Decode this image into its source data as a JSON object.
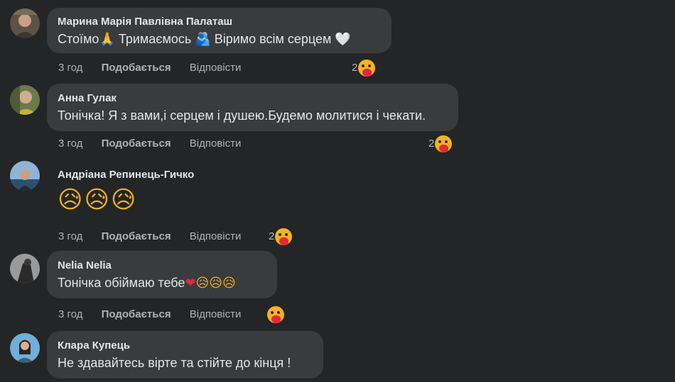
{
  "comments": [
    {
      "author": "Марина Марія Павлівна Палаташ",
      "text_parts": [
        "Стоїмо",
        "🙏",
        " Тримаємось ",
        "🫂",
        " Віримо всім серцем ",
        "🤍"
      ],
      "time": "3 год",
      "like": "Подобається",
      "reply": "Відповісти",
      "reaction_count": "2"
    },
    {
      "author": "Анна Гулак",
      "text": "Тонічка! Я з вами,і серцем і душею.Будемо молитися і чекати.",
      "time": "3 год",
      "like": "Подобається",
      "reply": "Відповісти",
      "reaction_count": "2"
    },
    {
      "author": "Андріана Репинець-Гичко",
      "emoji_text": "😥😥😥",
      "time": "3 год",
      "like": "Подобається",
      "reply": "Відповісти",
      "reaction_count": "2"
    },
    {
      "author": "Nelia Nelia",
      "text": "Тонічка обіймаю тебе",
      "text_emoji_heart": "❤",
      "text_emoji_tail": "😥😥😥",
      "time": "3 год",
      "like": "Подобається",
      "reply": "Відповісти",
      "reaction_count": ""
    },
    {
      "author": "Клара Купець",
      "text": "Не здавайтесь вірте та стійте до кінця !"
    }
  ],
  "colors": {
    "background": "#242526",
    "bubble": "#3a3b3c",
    "primary_text": "#e4e6eb",
    "secondary_text": "#b0b3b8"
  },
  "icons": {
    "reaction": "care-reaction-icon"
  }
}
